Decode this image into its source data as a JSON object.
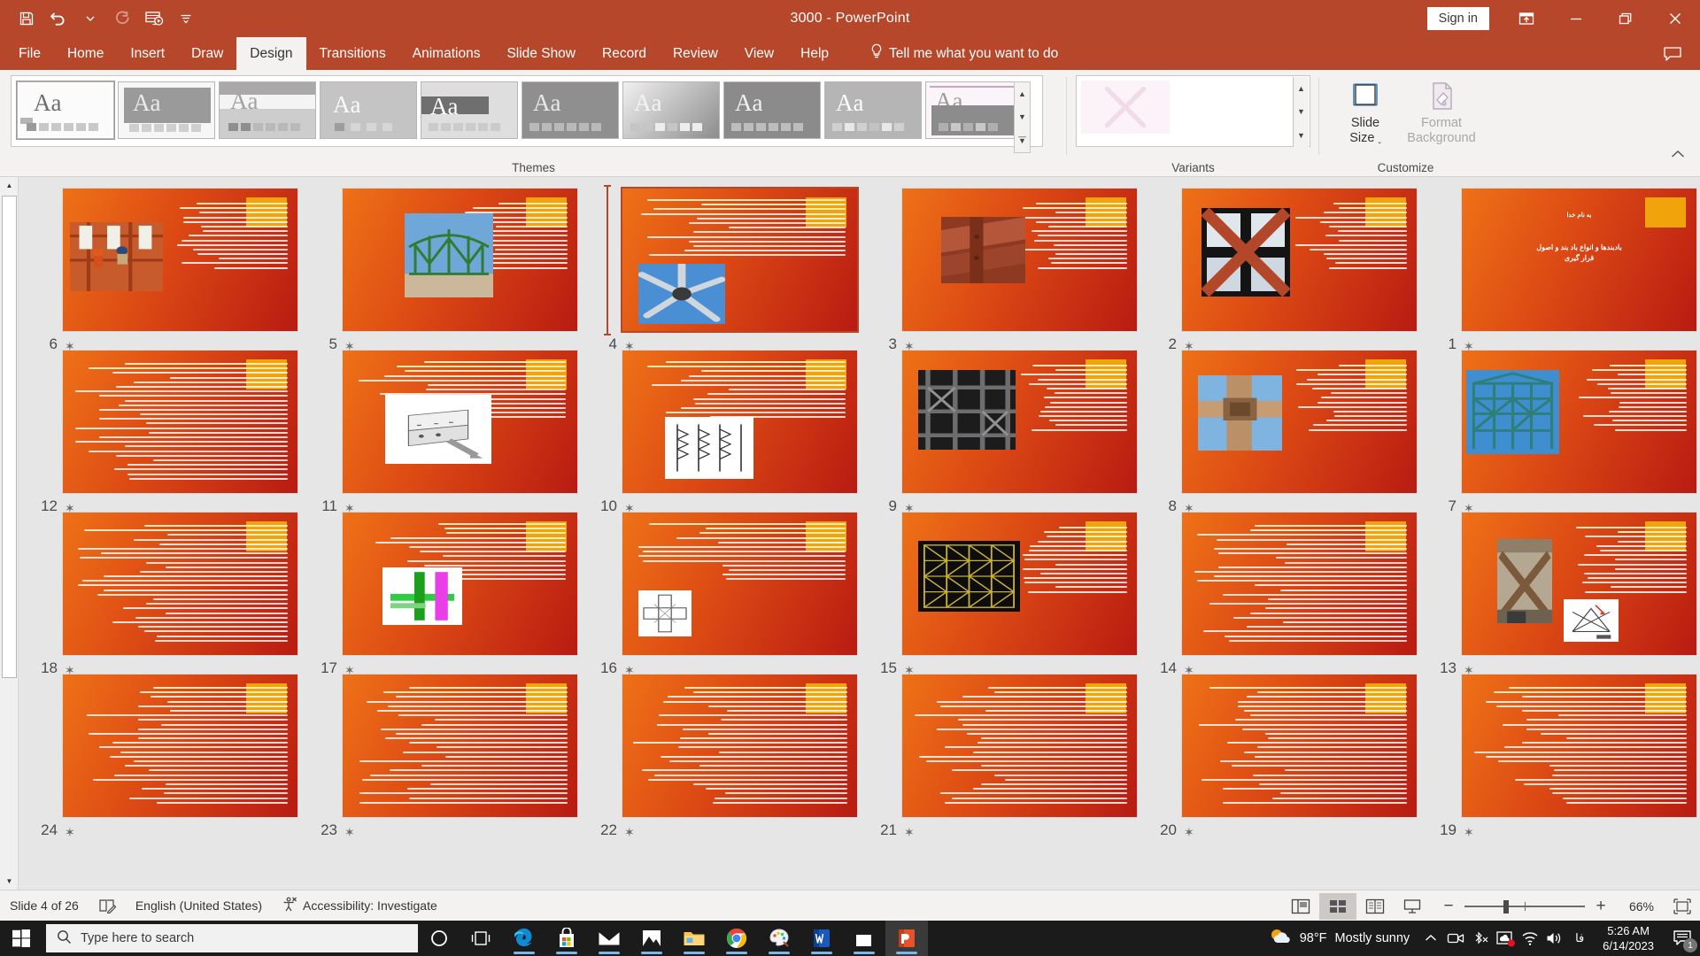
{
  "titlebar": {
    "document_title": "3000  -  PowerPoint",
    "signin_label": "Sign in",
    "qat": [
      {
        "name": "save",
        "label": "Save"
      },
      {
        "name": "undo",
        "label": "Undo"
      },
      {
        "name": "undo-dropdown",
        "label": "Undo options"
      },
      {
        "name": "redo",
        "label": "Redo"
      },
      {
        "name": "start-from-beginning",
        "label": "Start From Beginning"
      },
      {
        "name": "customize-qat",
        "label": "Customize Quick Access Toolbar"
      }
    ],
    "window_controls": [
      {
        "name": "ribbon-display-options",
        "label": "Ribbon Display Options"
      },
      {
        "name": "minimize",
        "label": "Minimize"
      },
      {
        "name": "restore",
        "label": "Restore Down"
      },
      {
        "name": "close",
        "label": "Close"
      }
    ]
  },
  "ribbon": {
    "tabs": [
      {
        "label": "File",
        "active": false
      },
      {
        "label": "Home",
        "active": false
      },
      {
        "label": "Insert",
        "active": false
      },
      {
        "label": "Draw",
        "active": false
      },
      {
        "label": "Design",
        "active": true
      },
      {
        "label": "Transitions",
        "active": false
      },
      {
        "label": "Animations",
        "active": false
      },
      {
        "label": "Slide Show",
        "active": false
      },
      {
        "label": "Record",
        "active": false
      },
      {
        "label": "Review",
        "active": false
      },
      {
        "label": "View",
        "active": false
      },
      {
        "label": "Help",
        "active": false
      }
    ],
    "tell_me": "Tell me what you want to do",
    "groups": {
      "themes": {
        "label": "Themes",
        "thumbnails": [
          {
            "id": 1,
            "aa": "Aa",
            "bg": "#fbfbfb",
            "aa_color": "#6d6d6d",
            "band": null,
            "bar_color": "#bdbdbd",
            "selected": true
          },
          {
            "id": 2,
            "aa": "Aa",
            "bg": "#f4f4f4",
            "aa_color": "#e9e9e9",
            "band": "#9a9a9a",
            "bar_color": "#cfcfcf",
            "selected": false
          },
          {
            "id": 3,
            "aa": "Aa",
            "bg": "#c9c9c9",
            "aa_color": "#f0f0f0",
            "band": "#a8a8a8",
            "bar_color": "#8f8f8f",
            "selected": false
          },
          {
            "id": 4,
            "aa": "Aa",
            "bg": "#c2c2c2",
            "aa_color": "#fafafa",
            "band": null,
            "bar_color": "#9d9d9d",
            "selected": false
          },
          {
            "id": 5,
            "aa": "Aa",
            "bg": "#dcdcdc",
            "aa_color": "#fbfbfb",
            "band": "#707070",
            "bar_color": "#cbcbcb",
            "selected": false
          },
          {
            "id": 6,
            "aa": "Aa",
            "bg": "#8c8c8c",
            "aa_color": "#e8e8e8",
            "band": null,
            "bar_color": "#b9b9b9",
            "selected": false
          },
          {
            "id": 7,
            "aa": "Aa",
            "bg": "#9d9d9d",
            "aa_color": "#f2f2f2",
            "band": null,
            "bar_color": "#c5c5c5",
            "selected": false
          },
          {
            "id": 8,
            "aa": "Aa",
            "bg": "#b7b7b7",
            "aa_color": "#fdfdfd",
            "band": null,
            "bar_color": "#d8d8d8",
            "selected": false
          },
          {
            "id": 9,
            "aa": "Aa",
            "bg": "#707070",
            "aa_color": "#f5f5f5",
            "band": null,
            "bar_color": "#a3a3a3",
            "selected": false
          },
          {
            "id": 10,
            "aa": "Aa",
            "bg": "#8e8e8e",
            "aa_color": "#efefef",
            "band": null,
            "bar_color": "#bcbcbc",
            "selected": false
          },
          {
            "id": 11,
            "aa": "Aa",
            "bg": "#fdf7fb",
            "aa_color": "#9a9a9a",
            "band": "#8b8b8b",
            "bar_color": "#b0b0b0",
            "selected": false
          }
        ],
        "scroll_buttons": [
          "scroll-up",
          "scroll-down",
          "more-themes"
        ]
      },
      "variants": {
        "label": "Variants",
        "scroll_buttons": [
          "scroll-up",
          "scroll-down",
          "more-variants"
        ]
      },
      "customize": {
        "label": "Customize",
        "slide_size": {
          "line1": "Slide",
          "line2": "Size",
          "enabled": true
        },
        "format_background": {
          "line1": "Format",
          "line2": "Background",
          "enabled": false
        }
      }
    },
    "collapse_label": "Collapse the Ribbon"
  },
  "sorter": {
    "slides": [
      {
        "n": 6,
        "layout": "image-left-text-right",
        "row": 0,
        "col": 0
      },
      {
        "n": 5,
        "layout": "image-left-text-right",
        "row": 0,
        "col": 1
      },
      {
        "n": 4,
        "layout": "text-top-image-bottom",
        "row": 0,
        "col": 2,
        "selected": true
      },
      {
        "n": 3,
        "layout": "image-left-text-right",
        "row": 0,
        "col": 3
      },
      {
        "n": 2,
        "layout": "image-left-text-right",
        "row": 0,
        "col": 4
      },
      {
        "n": 1,
        "layout": "title",
        "row": 0,
        "col": 5,
        "title_line1": "به نام خدا",
        "title_line2": "بادبندها و انواع باد بند و اصول",
        "title_line3": "قرار گیری"
      },
      {
        "n": 12,
        "layout": "text-only",
        "row": 1,
        "col": 0
      },
      {
        "n": 11,
        "layout": "text-top-image-bottom",
        "row": 1,
        "col": 1
      },
      {
        "n": 10,
        "layout": "text-top-image-bottom",
        "row": 1,
        "col": 2
      },
      {
        "n": 9,
        "layout": "image-left-text-right",
        "row": 1,
        "col": 3
      },
      {
        "n": 8,
        "layout": "image-left-text-right",
        "row": 1,
        "col": 4
      },
      {
        "n": 7,
        "layout": "image-left-text-right",
        "row": 1,
        "col": 5
      },
      {
        "n": 18,
        "layout": "text-only",
        "row": 2,
        "col": 0
      },
      {
        "n": 17,
        "layout": "text-top-image-bottom",
        "row": 2,
        "col": 1
      },
      {
        "n": 16,
        "layout": "text-top-image-bottom",
        "row": 2,
        "col": 2
      },
      {
        "n": 15,
        "layout": "image-left-text-right",
        "row": 2,
        "col": 3
      },
      {
        "n": 14,
        "layout": "text-only",
        "row": 2,
        "col": 4
      },
      {
        "n": 13,
        "layout": "image-left-text-right",
        "row": 2,
        "col": 5
      },
      {
        "n": 24,
        "layout": "text-only",
        "row": 3,
        "col": 0
      },
      {
        "n": 23,
        "layout": "text-only",
        "row": 3,
        "col": 1
      },
      {
        "n": 22,
        "layout": "text-only",
        "row": 3,
        "col": 2
      },
      {
        "n": 21,
        "layout": "text-only",
        "row": 3,
        "col": 3
      },
      {
        "n": 20,
        "layout": "text-only",
        "row": 3,
        "col": 4
      },
      {
        "n": 19,
        "layout": "text-only",
        "row": 3,
        "col": 5
      }
    ],
    "star_glyph": "✶"
  },
  "status": {
    "slide_counter": "Slide 4 of 26",
    "language": "English (United States)",
    "accessibility": "Accessibility: Investigate",
    "views": [
      {
        "name": "normal-view",
        "label": "Normal",
        "active": false
      },
      {
        "name": "slide-sorter-view",
        "label": "Slide Sorter",
        "active": true
      },
      {
        "name": "reading-view",
        "label": "Reading View",
        "active": false
      },
      {
        "name": "slide-show-view",
        "label": "Slide Show",
        "active": false
      }
    ],
    "zoom_out_label": "−",
    "zoom_in_label": "+",
    "zoom_level": "66%",
    "fit_label": "Fit slide to current window"
  },
  "taskbar": {
    "search_placeholder": "Type here to search",
    "apps": [
      {
        "name": "cortana",
        "label": "Cortana"
      },
      {
        "name": "task-view",
        "label": "Task View"
      },
      {
        "name": "microsoft-edge",
        "label": "Microsoft Edge"
      },
      {
        "name": "microsoft-store",
        "label": "Microsoft Store"
      },
      {
        "name": "mail",
        "label": "Mail"
      },
      {
        "name": "photos",
        "label": "Photos"
      },
      {
        "name": "file-explorer",
        "label": "File Explorer"
      },
      {
        "name": "google-chrome",
        "label": "Google Chrome"
      },
      {
        "name": "paint",
        "label": "Paint"
      },
      {
        "name": "microsoft-word",
        "label": "Microsoft Word"
      },
      {
        "name": "video-editor",
        "label": "Video Editor"
      },
      {
        "name": "microsoft-powerpoint",
        "label": "Microsoft PowerPoint"
      }
    ],
    "weather": {
      "temperature": "98°F",
      "condition": "Mostly sunny"
    },
    "clock": {
      "time": "5:26 AM",
      "date": "6/14/2023"
    },
    "notification_count": "1"
  }
}
